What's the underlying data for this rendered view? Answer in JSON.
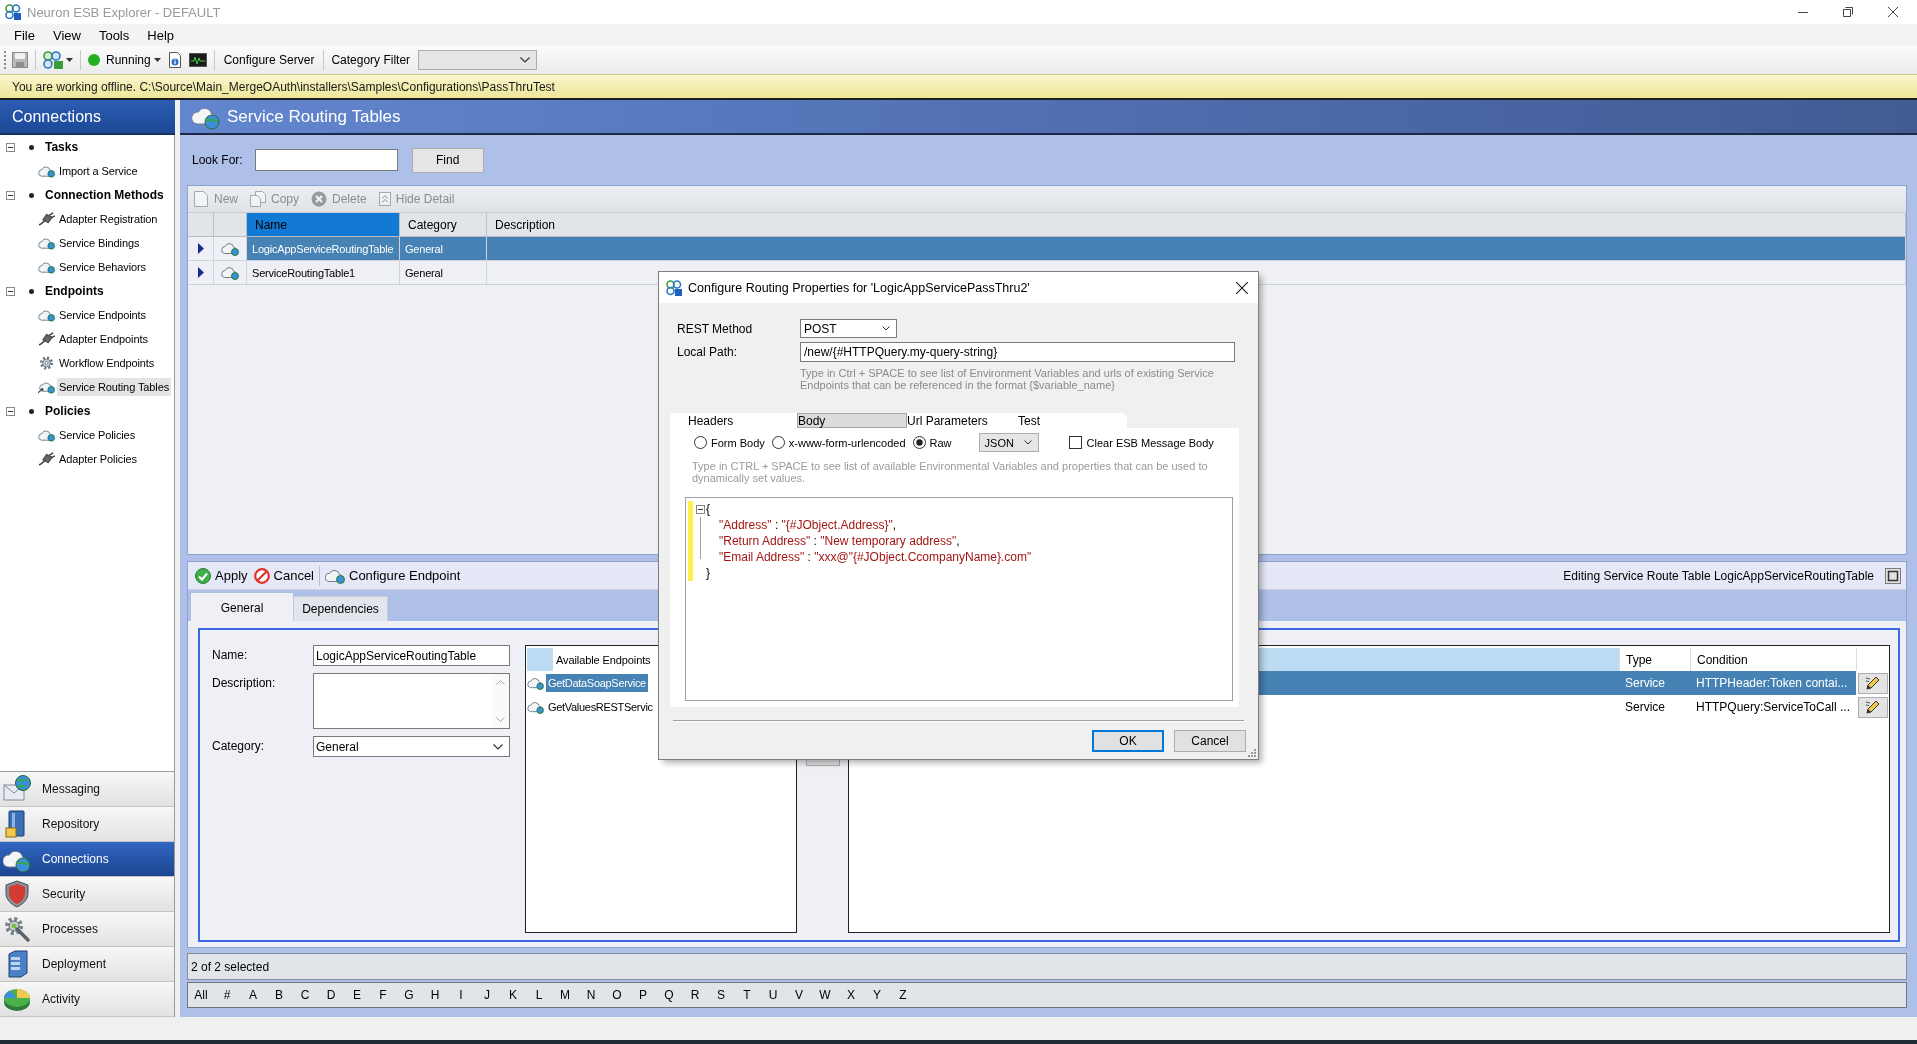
{
  "window": {
    "title": "Neuron ESB Explorer - DEFAULT"
  },
  "menu": [
    "File",
    "View",
    "Tools",
    "Help"
  ],
  "toolbar": {
    "status": {
      "label": "Running",
      "on": true
    },
    "buttons": [
      "Configure Server"
    ],
    "category_filter": {
      "label": "Category Filter"
    }
  },
  "offline_banner": "You are working offline. C:\\Source\\Main_MergeOAuth\\installers\\Samples\\Configurations\\PassThruTest",
  "sidebar": {
    "title": "Connections",
    "groups": [
      {
        "label": "Tasks",
        "expanded": true,
        "children": [
          {
            "label": "Import a Service",
            "kind": "service",
            "selected": false
          }
        ]
      },
      {
        "label": "Connection Methods",
        "expanded": true,
        "children": [
          {
            "label": "Adapter Registration",
            "kind": "adapter",
            "selected": false
          },
          {
            "label": "Service Bindings",
            "kind": "service",
            "selected": false
          },
          {
            "label": "Service Behaviors",
            "kind": "service",
            "selected": false
          }
        ]
      },
      {
        "label": "Endpoints",
        "expanded": true,
        "children": [
          {
            "label": "Service Endpoints",
            "kind": "service",
            "selected": false
          },
          {
            "label": "Adapter Endpoints",
            "kind": "adapter",
            "selected": false
          },
          {
            "label": "Workflow Endpoints",
            "kind": "workflow",
            "selected": false
          },
          {
            "label": "Service Routing Tables",
            "kind": "routing",
            "selected": true
          }
        ]
      },
      {
        "label": "Policies",
        "expanded": true,
        "children": [
          {
            "label": "Service Policies",
            "kind": "service",
            "selected": false
          },
          {
            "label": "Adapter Policies",
            "kind": "adapter",
            "selected": false
          }
        ]
      }
    ]
  },
  "nav_buttons": [
    {
      "label": "Messaging",
      "selected": false
    },
    {
      "label": "Repository",
      "selected": false
    },
    {
      "label": "Connections",
      "selected": true
    },
    {
      "label": "Security",
      "selected": false
    },
    {
      "label": "Processes",
      "selected": false
    },
    {
      "label": "Deployment",
      "selected": false
    },
    {
      "label": "Activity",
      "selected": false
    }
  ],
  "main": {
    "title": "Service Routing Tables",
    "search": {
      "label": "Look For:",
      "button": "Find"
    },
    "grid": {
      "toolbar": [
        {
          "label": "New",
          "kind": "new",
          "disabled": true
        },
        {
          "label": "Copy",
          "kind": "copy",
          "disabled": true
        },
        {
          "label": "Delete",
          "kind": "delete",
          "disabled": true
        },
        {
          "label": "Hide Detail",
          "kind": "hide",
          "disabled": true
        }
      ],
      "columns": [
        {
          "label": "Name",
          "selected": true
        },
        {
          "label": "Category",
          "selected": false
        },
        {
          "label": "Description",
          "selected": false
        }
      ],
      "rows": [
        {
          "name": "LogicAppServiceRoutingTable",
          "category": "General",
          "selected": true
        },
        {
          "name": "ServiceRoutingTable1",
          "category": "General",
          "selected": false
        }
      ]
    },
    "detail": {
      "toolbar": [
        {
          "label": "Apply",
          "kind": "apply"
        },
        {
          "label": "Cancel",
          "kind": "cancel"
        },
        {
          "label": "Configure Endpoint",
          "kind": "configure"
        }
      ],
      "caption": "Editing Service Route Table LogicAppServiceRoutingTable",
      "tabs": [
        {
          "label": "General",
          "selected": true
        },
        {
          "label": "Dependencies",
          "selected": false
        }
      ],
      "form": {
        "name": {
          "label": "Name:",
          "value": "LogicAppServiceRoutingTable"
        },
        "description": {
          "label": "Description:"
        },
        "category": {
          "label": "Category:",
          "value": "General"
        }
      },
      "available_endpoints": {
        "title": "Available Endpoints",
        "items": [
          {
            "label": "GetDataSoapService",
            "selected": true
          },
          {
            "label": "GetValuesRESTServic",
            "selected": false
          }
        ]
      },
      "routes": {
        "columns": [
          "Type",
          "Condition"
        ],
        "rows": [
          {
            "type": "Service",
            "condition": "HTTPHeader:Token contai...",
            "selected": true
          },
          {
            "type": "Service",
            "condition": "HTTPQuery:ServiceToCall ...",
            "selected": false
          }
        ]
      }
    },
    "status": "2 of 2 selected",
    "alphabet": [
      "All",
      "#",
      "A",
      "B",
      "C",
      "D",
      "E",
      "F",
      "G",
      "H",
      "I",
      "J",
      "K",
      "L",
      "M",
      "N",
      "O",
      "P",
      "Q",
      "R",
      "S",
      "T",
      "U",
      "V",
      "W",
      "X",
      "Y",
      "Z"
    ]
  },
  "dialog": {
    "title": "Configure Routing Properties for 'LogicAppServicePassThru2'",
    "rest_method": {
      "label": "REST Method",
      "value": "POST"
    },
    "local_path": {
      "label": "Local Path:",
      "value": "/new/{#HTTPQuery.my-query-string}",
      "hint": "Type in Ctrl + SPACE to see list of Environment Variables and urls of existing Service Endpoints that can be referenced in the format {$variable_name}"
    },
    "tabs": [
      {
        "label": "Headers",
        "selected": false
      },
      {
        "label": "Body",
        "selected": true
      },
      {
        "label": "Url Parameters",
        "selected": false
      },
      {
        "label": "Test",
        "selected": false
      }
    ],
    "body_modes": [
      {
        "label": "Form Body",
        "selected": false
      },
      {
        "label": "x-www-form-urlencoded",
        "selected": false
      },
      {
        "label": "Raw",
        "selected": true
      }
    ],
    "format": "JSON",
    "clear_body": {
      "label": "Clear ESB Message Body",
      "checked": false
    },
    "hint": "Type in CTRL + SPACE to see list of available Environmental Variables and properties that can be used to dynamically set values.",
    "code": {
      "open": "{",
      "close": "}",
      "expanded": true,
      "changed": true,
      "children": [
        {
          "tokens": [
            {
              "kind": "string",
              "text": "\"Address\""
            },
            {
              "kind": "plain",
              "text": " : "
            },
            {
              "kind": "string",
              "text": "\"{#JObject.Address}\""
            },
            {
              "kind": "plain",
              "text": ","
            }
          ]
        },
        {
          "tokens": [
            {
              "kind": "string",
              "text": "\"Return Address\""
            },
            {
              "kind": "plain",
              "text": " : "
            },
            {
              "kind": "string",
              "text": "\"New temporary address\""
            },
            {
              "kind": "plain",
              "text": ","
            }
          ]
        },
        {
          "tokens": [
            {
              "kind": "string",
              "text": "\"Email Address\""
            },
            {
              "kind": "plain",
              "text": " : "
            },
            {
              "kind": "string",
              "text": "\"xxx@\"{#JObject.CcompanyName}.com\""
            }
          ]
        }
      ]
    },
    "buttons": [
      {
        "label": "OK",
        "kind": "default"
      },
      {
        "label": "Cancel",
        "kind": "normal"
      }
    ]
  }
}
